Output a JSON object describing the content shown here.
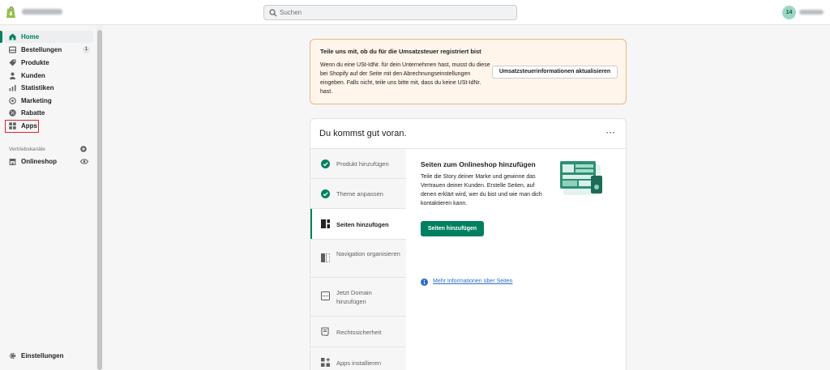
{
  "topbar": {
    "search_placeholder": "Suchen",
    "avatar_initials": "14"
  },
  "sidebar": {
    "items": [
      {
        "label": "Home",
        "icon": "home-icon",
        "active": true
      },
      {
        "label": "Bestellungen",
        "icon": "orders-icon",
        "badge": "1"
      },
      {
        "label": "Produkte",
        "icon": "tag-icon"
      },
      {
        "label": "Kunden",
        "icon": "person-icon"
      },
      {
        "label": "Statistiken",
        "icon": "bar-chart-icon"
      },
      {
        "label": "Marketing",
        "icon": "target-icon"
      },
      {
        "label": "Rabatte",
        "icon": "discount-icon"
      },
      {
        "label": "Apps",
        "icon": "apps-grid-icon"
      }
    ],
    "channels_title": "Vertriebskanäle",
    "channels": [
      {
        "label": "Onlineshop",
        "icon": "store-icon"
      }
    ],
    "settings_label": "Einstellungen"
  },
  "banner": {
    "title": "Teile uns mit, ob du für die Umsatzsteuer registriert bist",
    "text": "Wenn du eine USt-IdNr. für dein Unternehmen hast, musst du diese bei Shopify auf der Seite mit den Abrechnungseinstellungen eingeben. Falls nicht, teile uns bitte mit, dass du keine USt-IdNr. hast.",
    "button": "Umsatzsteuerinformationen aktualisieren"
  },
  "setup_card": {
    "title": "Du kommst gut voran.",
    "more": "···",
    "steps": [
      {
        "label": "Produkt hinzufügen",
        "icon": "check-circle-icon",
        "done": true
      },
      {
        "label": "Theme anpassen",
        "icon": "check-circle-icon",
        "done": true
      },
      {
        "label": "Seiten hinzufügen",
        "icon": "pages-icon",
        "active": true
      },
      {
        "label": "Navigation organisieren",
        "icon": "navigation-icon"
      },
      {
        "label": "Jetzt Domain hinzufügen",
        "icon": "domain-icon"
      },
      {
        "label": "Rechtssicherheit",
        "icon": "legal-icon"
      },
      {
        "label": "Apps installieren",
        "icon": "apps-add-icon"
      }
    ],
    "content": {
      "title": "Seiten zum Onlineshop hinzufügen",
      "text": "Teile die Story deiner Marke und gewinne das Vertrauen deiner Kunden. Erstelle Seiten, auf denen erklärt wird, wer du bist und wie man dich kontaktieren kann.",
      "button": "Seiten hinzufügen",
      "link": "Mehr Informationen über Seiten"
    }
  },
  "colors": {
    "accent": "#008060",
    "banner_bg": "#fff5ea",
    "link": "#2c6ecb",
    "highlight": "#e1222e"
  }
}
